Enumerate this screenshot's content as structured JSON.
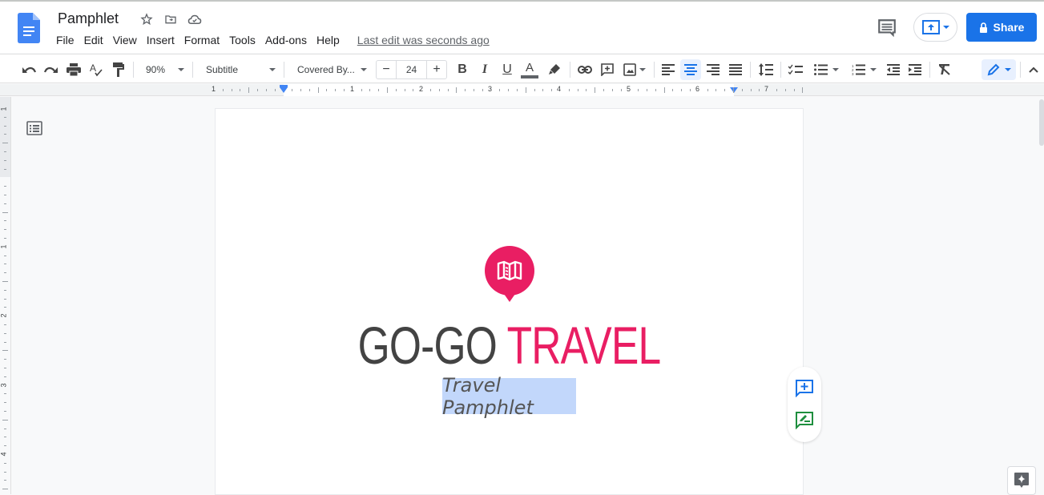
{
  "app": {
    "doc_title": "Pamphlet",
    "menu": [
      "File",
      "Edit",
      "View",
      "Insert",
      "Format",
      "Tools",
      "Add-ons",
      "Help"
    ],
    "last_edit": "Last edit was seconds ago",
    "share_label": "Share"
  },
  "toolbar": {
    "zoom": "90%",
    "style": "Subtitle",
    "font": "Covered By...",
    "font_size": "24",
    "active_alignment": "center",
    "mode_icon": "pencil-icon"
  },
  "ruler": {
    "h_labels": [
      "1",
      "1",
      "2",
      "3",
      "4",
      "5",
      "6",
      "7"
    ],
    "v_labels": [
      "1",
      "1",
      "2",
      "3",
      "4"
    ]
  },
  "document": {
    "title_part1": "GO-GO",
    "title_part2": "TRAVEL",
    "subtitle": "Travel Pamphlet",
    "colors": {
      "accent": "#e91e63",
      "title_dark": "#434343",
      "selection": "#c2d7fb"
    }
  },
  "icons": {
    "logo": "google-docs-icon",
    "star": "star-icon",
    "move": "move-to-folder-icon",
    "cloud": "cloud-saved-icon",
    "comments": "comment-history-icon",
    "present": "present-icon",
    "lock": "lock-icon",
    "map": "map-icon"
  },
  "colors": {
    "brand": "#1a73e8"
  }
}
